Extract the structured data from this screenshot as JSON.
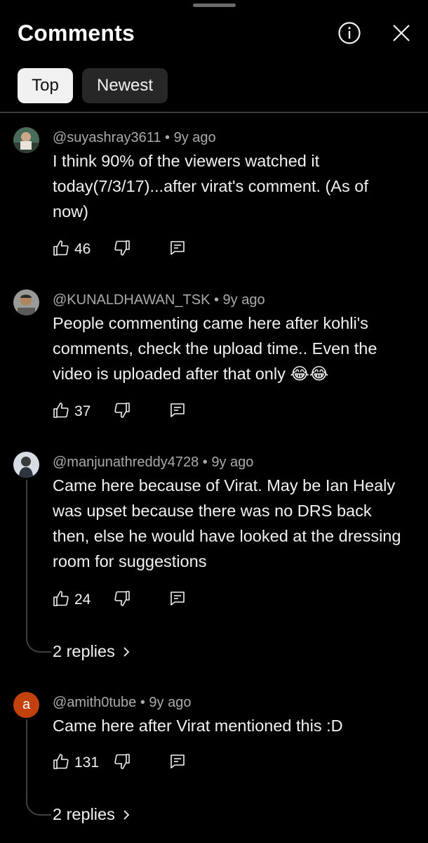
{
  "header": {
    "title": "Comments",
    "info_icon": "info-circle-icon",
    "close_icon": "close-icon"
  },
  "filters": [
    {
      "label": "Top",
      "selected": true
    },
    {
      "label": "Newest",
      "selected": false
    }
  ],
  "comments": [
    {
      "handle": "@suyashray3611",
      "age": "9y ago",
      "text": "I think 90% of the viewers watched it today(7/3/17)...after virat's comment.  (As of now)",
      "likes": "46",
      "avatar": "photo"
    },
    {
      "handle": "@KUNALDHAWAN_TSK",
      "age": "9y ago",
      "text": "People commenting came here after kohli's comments, check the upload time.. Even the video is uploaded after that only 😂😂",
      "likes": "37",
      "avatar": "photo"
    },
    {
      "handle": "@manjunathreddy4728",
      "age": "9y ago",
      "text": "Came here because of Virat.  May be Ian Healy was upset because there was no DRS back then, else he would have looked at the dressing room for suggestions",
      "likes": "24",
      "replies": "2 replies",
      "avatar": "photo"
    },
    {
      "handle": "@amith0tube",
      "age": "9y ago",
      "text": "Came here after Virat mentioned this :D",
      "likes": "131",
      "replies": "2 replies",
      "avatar_letter": "a",
      "avatar_color": "#c2410c"
    }
  ],
  "colors": {
    "background": "#000000",
    "text": "#f1f1f1",
    "meta": "#aaaaaa",
    "chip_selected_bg": "#f1f1f1",
    "chip_bg": "#272727"
  }
}
